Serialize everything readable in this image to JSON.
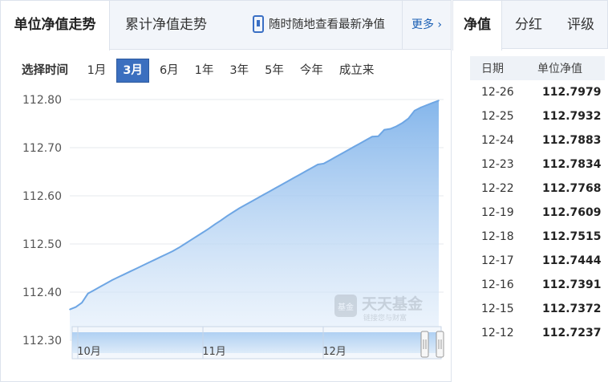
{
  "left_tabs": [
    "单位净值走势",
    "累计净值走势"
  ],
  "mobile_link": "随时随地查看最新净值",
  "more_link": "更多",
  "range": {
    "label": "选择时间",
    "options": [
      "1月",
      "3月",
      "6月",
      "1年",
      "3年",
      "5年",
      "今年",
      "成立来"
    ],
    "selected": "3月"
  },
  "chart_data": {
    "type": "area",
    "title": "",
    "xlabel": "",
    "ylabel": "",
    "ylim": [
      112.3,
      112.8
    ],
    "y_ticks": [
      "112.80",
      "112.70",
      "112.60",
      "112.50",
      "112.40",
      "112.30"
    ],
    "x_ticks": [
      "10月",
      "11月",
      "12月"
    ],
    "series": [
      {
        "values": [
          112.364,
          112.369,
          112.378,
          112.397,
          112.404,
          112.411,
          112.418,
          112.425,
          112.431,
          112.437,
          112.443,
          112.449,
          112.455,
          112.461,
          112.467,
          112.473,
          112.479,
          112.485,
          112.492,
          112.5,
          112.508,
          112.516,
          112.524,
          112.532,
          112.541,
          112.549,
          112.558,
          112.566,
          112.574,
          112.581,
          112.588,
          112.595,
          112.602,
          112.609,
          112.616,
          112.623,
          112.63,
          112.637,
          112.644,
          112.651,
          112.658,
          112.665,
          112.667,
          112.674,
          112.681,
          112.688,
          112.695,
          112.702,
          112.709,
          112.716,
          112.723,
          112.7237,
          112.7372,
          112.7391,
          112.7444,
          112.7515,
          112.7609,
          112.7768,
          112.7834,
          112.7883,
          112.7932,
          112.7979
        ]
      }
    ],
    "grid": true,
    "color": "#6ea6e4"
  },
  "watermark": {
    "name": "天天基金",
    "slogan": "链接您与财富",
    "badge": "基金"
  },
  "right_tabs": [
    "净值",
    "分红",
    "评级"
  ],
  "nav_table": {
    "headers": [
      "日期",
      "单位净值"
    ],
    "rows": [
      [
        "12-26",
        "112.7979"
      ],
      [
        "12-25",
        "112.7932"
      ],
      [
        "12-24",
        "112.7883"
      ],
      [
        "12-23",
        "112.7834"
      ],
      [
        "12-22",
        "112.7768"
      ],
      [
        "12-19",
        "112.7609"
      ],
      [
        "12-18",
        "112.7515"
      ],
      [
        "12-17",
        "112.7444"
      ],
      [
        "12-16",
        "112.7391"
      ],
      [
        "12-15",
        "112.7372"
      ],
      [
        "12-12",
        "112.7237"
      ]
    ]
  }
}
